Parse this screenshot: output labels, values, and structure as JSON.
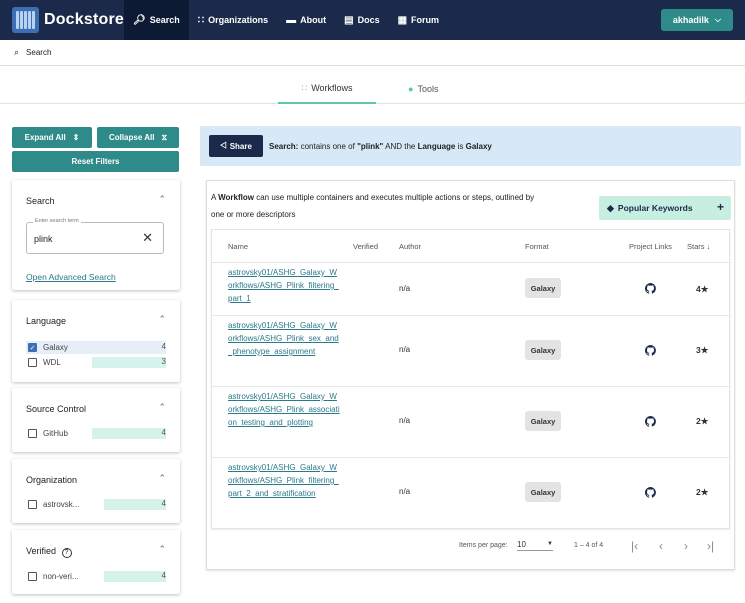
{
  "nav": {
    "brand": "Dockstore",
    "items": [
      {
        "label": "Search",
        "icon": "search-icon",
        "active": true
      },
      {
        "label": "Organizations",
        "icon": "organizations-icon"
      },
      {
        "label": "About",
        "icon": "about-icon"
      },
      {
        "label": "Docs",
        "icon": "docs-icon"
      },
      {
        "label": "Forum",
        "icon": "forum-icon"
      }
    ],
    "user": "akhadilk"
  },
  "breadcrumb": "Search",
  "tabs": [
    {
      "label": "Workflows",
      "active": true
    },
    {
      "label": "Tools",
      "active": false
    }
  ],
  "sidebar": {
    "expand_all": "Expand All",
    "collapse_all": "Collapse All",
    "reset_filters": "Reset Filters",
    "search": {
      "title": "Search",
      "field_label": "Enter search term",
      "value": "plink",
      "advanced_link": "Open Advanced Search"
    },
    "facets": [
      {
        "title": "Language",
        "items": [
          {
            "label": "Galaxy",
            "count": "4",
            "checked": true,
            "fraction": 0
          },
          {
            "label": "WDL",
            "count": "3",
            "checked": false,
            "fraction": 0.75
          }
        ]
      },
      {
        "title": "Source Control",
        "items": [
          {
            "label": "GitHub",
            "count": "4",
            "checked": false,
            "fraction": 1
          }
        ]
      },
      {
        "title": "Organization",
        "items": [
          {
            "label": "astrovsk...",
            "count": "4",
            "checked": false,
            "fraction": 1
          }
        ]
      },
      {
        "title": "Verified",
        "items": [
          {
            "label": "non-veri...",
            "count": "4",
            "checked": false,
            "fraction": 1
          }
        ]
      }
    ]
  },
  "banner": {
    "share": "Share",
    "search_label": "Search:",
    "text_1": " contains one of ",
    "term": "\"plink\"",
    "text_2": " AND the ",
    "lang_label": "Language",
    "text_3": " is ",
    "lang_value": "Galaxy"
  },
  "description": {
    "prefix": "A ",
    "bold": "Workflow",
    "rest": " can use multiple containers and executes multiple actions or steps, outlined by one or more descriptors"
  },
  "keywords_button": "Popular Keywords",
  "table": {
    "headers": [
      "Name",
      "Verified",
      "Author",
      "Format",
      "Project Links",
      "Stars"
    ],
    "rows": [
      {
        "name": "astrovsky01/ASHG_Galaxy_Workflows/ASHG_Plink_filtering_part_1",
        "author": "n/a",
        "format": "Galaxy",
        "stars": "4"
      },
      {
        "name": "astrovsky01/ASHG_Galaxy_Workflows/ASHG_Plink_sex_and_phenotype_assignment",
        "author": "n/a",
        "format": "Galaxy",
        "stars": "3"
      },
      {
        "name": "astrovsky01/ASHG_Galaxy_Workflows/ASHG_Plink_association_testing_and_plotting",
        "author": "n/a",
        "format": "Galaxy",
        "stars": "2"
      },
      {
        "name": "astrovsky01/ASHG_Galaxy_Workflows/ASHG_Plink_filtering_part_2_and_stratification",
        "author": "n/a",
        "format": "Galaxy",
        "stars": "2"
      }
    ]
  },
  "pagination": {
    "label": "Items per page:",
    "per_page": "10",
    "range": "1 – 4 of 4"
  },
  "colors": {
    "navbar": "#1b2a4a",
    "accent": "#2f8a8a",
    "mint": "#5cc7a8",
    "link": "#2a7a8a"
  }
}
